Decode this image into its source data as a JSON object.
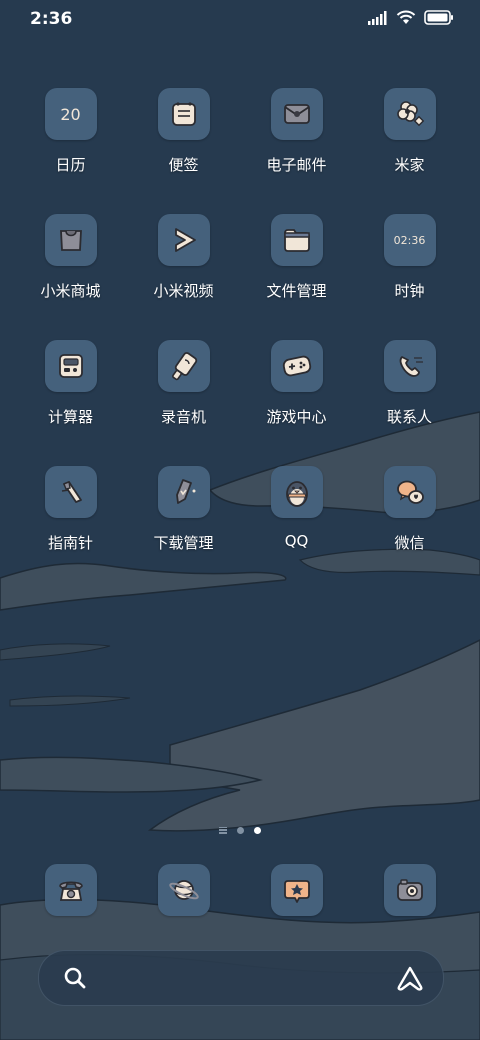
{
  "status_bar": {
    "time": "2:36",
    "icons": [
      "signal-icon",
      "wifi-icon",
      "battery-icon"
    ]
  },
  "apps": [
    {
      "label": "日历",
      "icon": "calendar-icon",
      "tile_text": "20"
    },
    {
      "label": "便签",
      "icon": "notes-icon"
    },
    {
      "label": "电子邮件",
      "icon": "mail-icon"
    },
    {
      "label": "米家",
      "icon": "mijia-flower-icon"
    },
    {
      "label": "小米商城",
      "icon": "shop-bag-icon"
    },
    {
      "label": "小米视频",
      "icon": "video-play-icon"
    },
    {
      "label": "文件管理",
      "icon": "folder-icon"
    },
    {
      "label": "时钟",
      "icon": "clock-icon",
      "tile_text": "02:36"
    },
    {
      "label": "计算器",
      "icon": "calculator-icon"
    },
    {
      "label": "录音机",
      "icon": "recorder-icon"
    },
    {
      "label": "游戏中心",
      "icon": "gamepad-icon"
    },
    {
      "label": "联系人",
      "icon": "phone-contact-icon"
    },
    {
      "label": "指南针",
      "icon": "compass-icon"
    },
    {
      "label": "下载管理",
      "icon": "download-icon"
    },
    {
      "label": "QQ",
      "icon": "qq-penguin-icon"
    },
    {
      "label": "微信",
      "icon": "wechat-chat-icon"
    }
  ],
  "page_indicator": {
    "pages": 2,
    "active_page": 2
  },
  "dock": [
    {
      "icon": "telephone-icon"
    },
    {
      "icon": "browser-planet-icon"
    },
    {
      "icon": "app-store-icon"
    },
    {
      "icon": "camera-icon"
    }
  ],
  "search_bar": {
    "search_icon": "search-icon",
    "assistant_icon": "assistant-icon"
  },
  "colors": {
    "background": "#263a4f",
    "tile": "#45617c",
    "icon_cream": "#f1e6d8",
    "icon_outline": "#2b2b30",
    "text": "#ffffff"
  }
}
